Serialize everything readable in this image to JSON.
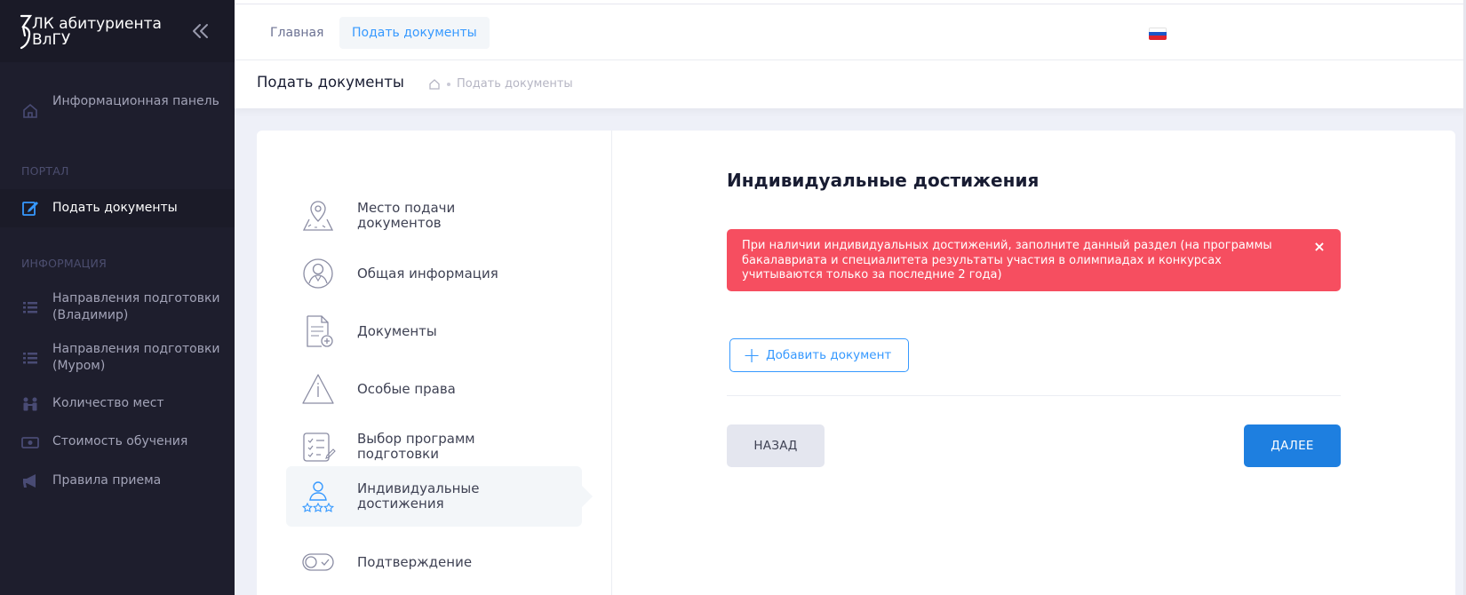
{
  "app": {
    "logo_text": "ЛК абитуриента ВлГУ"
  },
  "sidebar": {
    "items": [
      {
        "label": "Информационная панель",
        "icon": "home-icon"
      },
      {
        "label": "Подать документы",
        "icon": "edit-icon",
        "active": true
      },
      {
        "label": "Направления подготовки (Владимир)",
        "icon": "list-icon"
      },
      {
        "label": "Направления подготовки (Муром)",
        "icon": "list-icon"
      },
      {
        "label": "Количество мест",
        "icon": "people-icon"
      },
      {
        "label": "Стоимость обучения",
        "icon": "money-icon"
      },
      {
        "label": "Правила приема",
        "icon": "megaphone-icon"
      }
    ],
    "sections": {
      "portal": "ПОРТАЛ",
      "info": "ИНФОРМАЦИЯ"
    }
  },
  "topbar": {
    "tabs": [
      {
        "label": "Главная"
      },
      {
        "label": "Подать документы",
        "active": true
      }
    ],
    "language_flag": "russian-flag-icon"
  },
  "subheader": {
    "title": "Подать документы",
    "breadcrumb": "Подать документы"
  },
  "wizard": {
    "steps": [
      {
        "label": "Место подачи документов",
        "icon": "map-pin-icon"
      },
      {
        "label": "Общая информация",
        "icon": "user-circle-icon"
      },
      {
        "label": "Документы",
        "icon": "document-add-icon"
      },
      {
        "label": "Особые права",
        "icon": "warning-icon"
      },
      {
        "label": "Выбор программ подготовки",
        "icon": "checklist-icon"
      },
      {
        "label": "Индивидуальные достижения",
        "icon": "achievement-icon",
        "active": true
      },
      {
        "label": "Подтверждение",
        "icon": "toggle-icon"
      }
    ]
  },
  "content": {
    "title": "Индивидуальные достижения",
    "alert_text": "При наличии индивидуальных достижений, заполните данный раздел (на программы бакалавриата и специалитета результаты участия в олимпиадах и конкурсах учитываются только за последние 2 года)",
    "alert_close": "×",
    "add_button": "Добавить документ",
    "back_button": "НАЗАД",
    "next_button": "ДАЛЕЕ"
  },
  "colors": {
    "sidebar_bg": "#1e1e2d",
    "accent": "#3699ff",
    "danger": "#f64e60",
    "primary_button": "#1e7fe0"
  }
}
